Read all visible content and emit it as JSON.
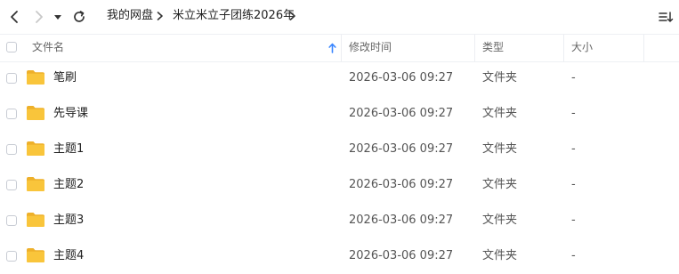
{
  "breadcrumb": [
    "我的网盘",
    "米立米立子团练2026年"
  ],
  "header": {
    "name": "文件名",
    "modified": "修改时间",
    "type": "类型",
    "size": "大小"
  },
  "rows": [
    {
      "name": "笔刷",
      "modified": "2026-03-06 09:27",
      "type": "文件夹",
      "size": "-"
    },
    {
      "name": "先导课",
      "modified": "2026-03-06 09:27",
      "type": "文件夹",
      "size": "-"
    },
    {
      "name": "主题1",
      "modified": "2026-03-06 09:27",
      "type": "文件夹",
      "size": "-"
    },
    {
      "name": "主题2",
      "modified": "2026-03-06 09:27",
      "type": "文件夹",
      "size": "-"
    },
    {
      "name": "主题3",
      "modified": "2026-03-06 09:27",
      "type": "文件夹",
      "size": "-"
    },
    {
      "name": "主题4",
      "modified": "2026-03-06 09:27",
      "type": "文件夹",
      "size": "-"
    }
  ],
  "colors": {
    "folder": "#f9c53b",
    "folder_tab": "#eeb02a",
    "sort_arrow": "#3a86ff",
    "disabled_icon": "#c8c8c8"
  },
  "icons": [
    "back-arrow-icon",
    "forward-arrow-icon",
    "dropdown-caret-icon",
    "refresh-icon",
    "chevron-right-icon",
    "sort-up-arrow-icon",
    "view-sort-icon",
    "folder-icon"
  ]
}
